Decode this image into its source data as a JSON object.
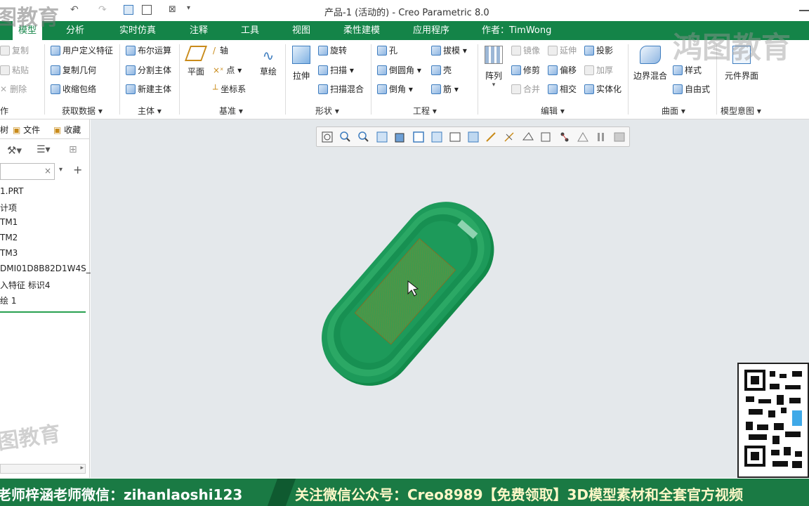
{
  "window": {
    "title": "产品-1 (活动的) - Creo Parametric 8.0"
  },
  "menu": {
    "tabs": [
      "模型",
      "分析",
      "实时仿真",
      "注释",
      "工具",
      "视图",
      "柔性建模",
      "应用程序"
    ],
    "author": "作者：TimWong"
  },
  "ribbon": {
    "operations": {
      "copy": "复制",
      "paste": "粘贴",
      "delete": "删除",
      "label": "作"
    },
    "get_data": {
      "udf": "用户定义特征",
      "copy_geom": "复制几何",
      "shrinkwrap": "收缩包络",
      "label": "获取数据"
    },
    "body": {
      "boolean": "布尔运算",
      "split": "分割主体",
      "new": "新建主体",
      "label": "主体"
    },
    "datum": {
      "plane": "平面",
      "axis": "轴",
      "point": "点",
      "csys": "坐标系",
      "sketch": "草绘",
      "label": "基准"
    },
    "shapes": {
      "extrude": "拉伸",
      "revolve": "旋转",
      "sweep": "扫描",
      "swept_blend": "扫描混合",
      "label": "形状"
    },
    "engineering": {
      "hole": "孔",
      "round": "倒圆角",
      "chamfer": "倒角",
      "draft": "拔模",
      "shell": "壳",
      "rib": "筋",
      "label": "工程"
    },
    "editing": {
      "pattern": "阵列",
      "mirror": "镜像",
      "extend": "延伸",
      "project": "投影",
      "trim": "修剪",
      "offset": "偏移",
      "thicken": "加厚",
      "merge": "合并",
      "intersect": "相交",
      "solidify": "实体化",
      "label": "编辑"
    },
    "surfaces": {
      "boundary_blend": "边界混合",
      "style": "样式",
      "freestyle": "自由式",
      "label": "曲面"
    },
    "model_intent": {
      "component_interface": "元件界面",
      "label": "模型意图"
    }
  },
  "left_panel": {
    "tabs": [
      "树",
      "文件",
      "收藏"
    ],
    "tree": [
      "1.PRT",
      "计项",
      "TM1",
      "TM2",
      "TM3",
      "DMI01D8B82D1W4S_",
      "入特征 标识4",
      "绘 1"
    ]
  },
  "banner": {
    "left": "老师梓涵老师微信：zihanlaoshi123",
    "right": "关注微信公众号：Creo8989【免费领取】3D模型素材和全套官方视频"
  },
  "watermark": {
    "text_top": "图教育",
    "text_right": "鸿图教育",
    "text_left": "图教育"
  },
  "colors": {
    "brand_green": "#148448",
    "model_green": "#1d9a5a",
    "viewport_bg": "#e4e8eb"
  },
  "icons": [
    "save-icon",
    "undo-icon",
    "redo-icon",
    "regenerate-icon",
    "window-icon",
    "close-icon",
    "zoom-in-icon",
    "zoom-out-icon",
    "refit-icon",
    "cursor-icon"
  ]
}
